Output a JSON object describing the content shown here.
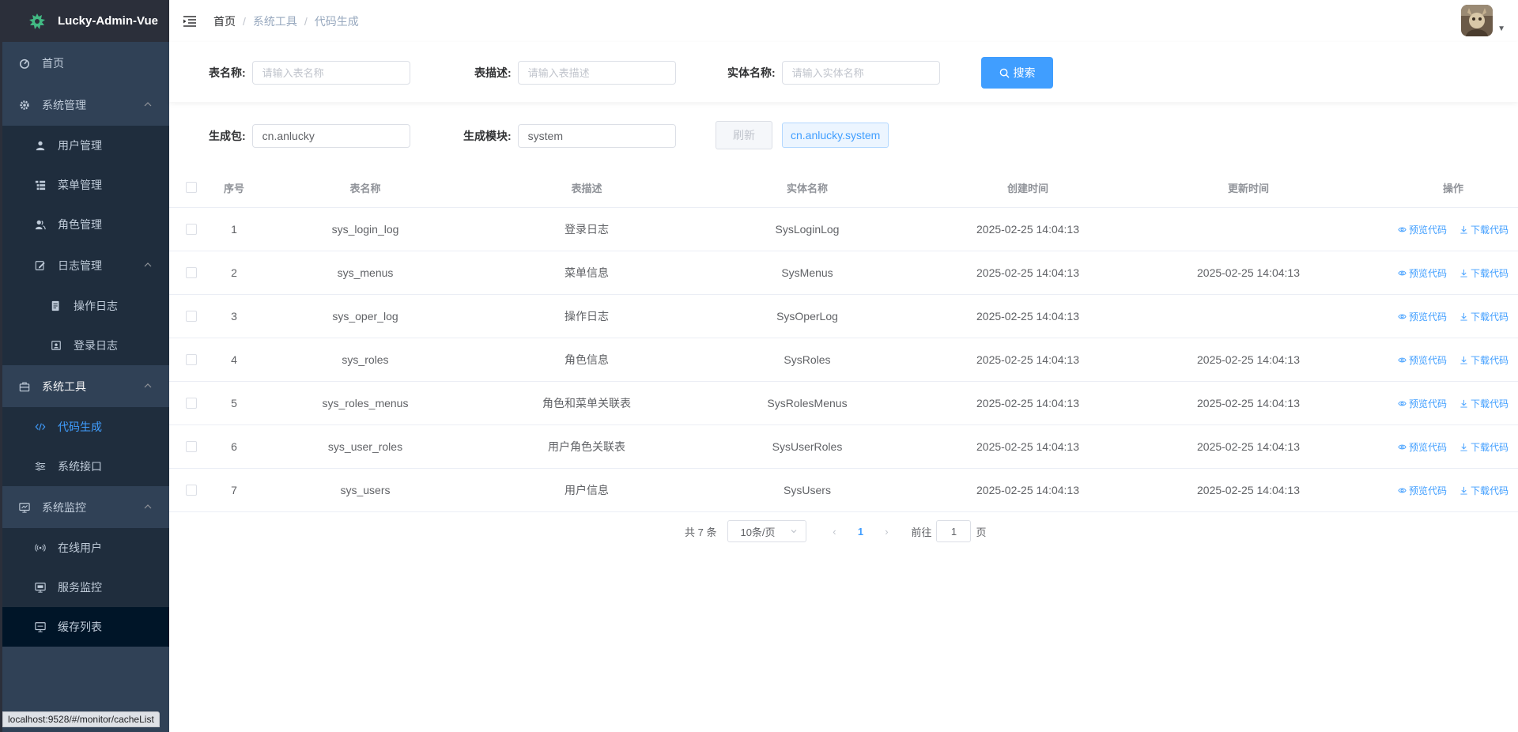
{
  "app": {
    "title": "Lucky-Admin-Vue"
  },
  "sidebar": {
    "home": "首页",
    "system": {
      "title": "系统管理",
      "items": [
        "用户管理",
        "菜单管理",
        "角色管理"
      ],
      "log": {
        "title": "日志管理",
        "items": [
          "操作日志",
          "登录日志"
        ]
      }
    },
    "tools": {
      "title": "系统工具",
      "items": [
        "代码生成",
        "系统接口"
      ]
    },
    "monitor": {
      "title": "系统监控",
      "items": [
        "在线用户",
        "服务监控",
        "缓存列表"
      ]
    }
  },
  "header": {
    "breadcrumb": [
      "首页",
      "系统工具",
      "代码生成"
    ]
  },
  "search": {
    "table_name": {
      "label": "表名称:",
      "placeholder": "请输入表名称"
    },
    "table_desc": {
      "label": "表描述:",
      "placeholder": "请输入表描述"
    },
    "entity_name": {
      "label": "实体名称:",
      "placeholder": "请输入实体名称"
    },
    "button": "搜索"
  },
  "generate": {
    "package": {
      "label": "生成包:",
      "value": "cn.anlucky"
    },
    "module": {
      "label": "生成模块:",
      "value": "system"
    },
    "refresh_button": "刷新",
    "preview_tag": "cn.anlucky.system"
  },
  "table": {
    "headers": [
      "序号",
      "表名称",
      "表描述",
      "实体名称",
      "创建时间",
      "更新时间",
      "操作"
    ],
    "rows": [
      {
        "idx": "1",
        "name": "sys_login_log",
        "desc": "登录日志",
        "entity": "SysLoginLog",
        "created": "2025-02-25 14:04:13",
        "updated": ""
      },
      {
        "idx": "2",
        "name": "sys_menus",
        "desc": "菜单信息",
        "entity": "SysMenus",
        "created": "2025-02-25 14:04:13",
        "updated": "2025-02-25 14:04:13"
      },
      {
        "idx": "3",
        "name": "sys_oper_log",
        "desc": "操作日志",
        "entity": "SysOperLog",
        "created": "2025-02-25 14:04:13",
        "updated": ""
      },
      {
        "idx": "4",
        "name": "sys_roles",
        "desc": "角色信息",
        "entity": "SysRoles",
        "created": "2025-02-25 14:04:13",
        "updated": "2025-02-25 14:04:13"
      },
      {
        "idx": "5",
        "name": "sys_roles_menus",
        "desc": "角色和菜单关联表",
        "entity": "SysRolesMenus",
        "created": "2025-02-25 14:04:13",
        "updated": "2025-02-25 14:04:13"
      },
      {
        "idx": "6",
        "name": "sys_user_roles",
        "desc": "用户角色关联表",
        "entity": "SysUserRoles",
        "created": "2025-02-25 14:04:13",
        "updated": "2025-02-25 14:04:13"
      },
      {
        "idx": "7",
        "name": "sys_users",
        "desc": "用户信息",
        "entity": "SysUsers",
        "created": "2025-02-25 14:04:13",
        "updated": "2025-02-25 14:04:13"
      }
    ],
    "actions": {
      "preview": "预览代码",
      "download": "下载代码"
    }
  },
  "pagination": {
    "total": "共 7 条",
    "page_size": "10条/页",
    "current": "1",
    "goto_prefix": "前往",
    "goto_value": "1",
    "goto_suffix": "页"
  },
  "statusbar": {
    "url": "localhost:9528/#/monitor/cacheList"
  },
  "colors": {
    "sidebar_bg": "#304156",
    "submenu_bg": "#1f2d3d",
    "accent": "#409eff"
  }
}
